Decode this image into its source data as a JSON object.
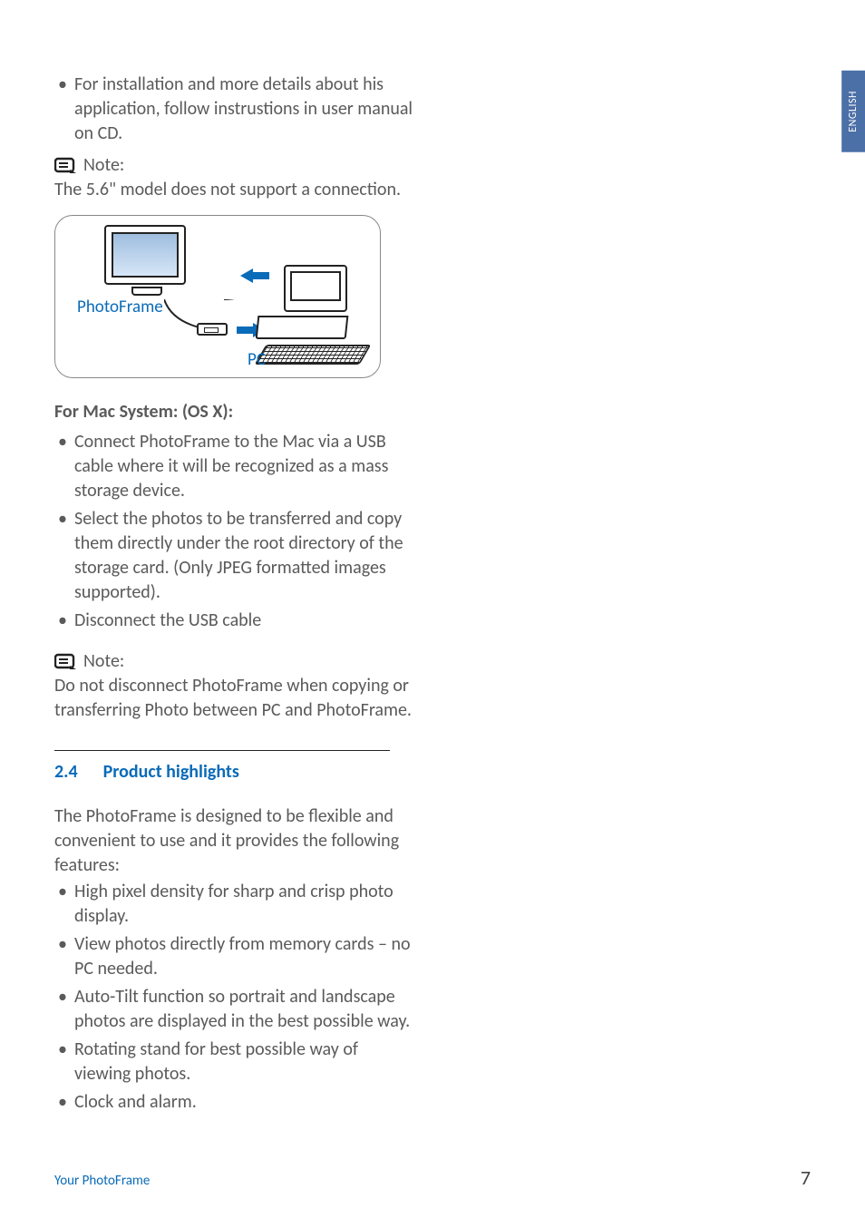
{
  "sideTab": "ENGLISH",
  "topBullet": "For installation and more details about his application, follow instrustions in user manual on CD.",
  "note1": {
    "label": "Note:",
    "body": "The 5.6\" model  does not support a connection."
  },
  "diagram": {
    "photoFrameLabel": "PhotoFrame",
    "pcLabel": "PC"
  },
  "macHeading": "For Mac System: (OS X):",
  "macBullets": [
    "Connect PhotoFrame to the Mac via a USB cable where it will be recognized as a mass storage device.",
    "Select the photos to be transferred and copy them directly under the root directory of the storage card. (Only JPEG formatted images supported).",
    "Disconnect the USB cable"
  ],
  "note2": {
    "label": "Note:",
    "body": "Do not disconnect PhotoFrame when copying or transferring Photo between PC and PhotoFrame."
  },
  "section": {
    "number": "2.4",
    "title": "Product highlights"
  },
  "highlightsIntro": "The PhotoFrame is designed to be flexible and convenient to use and it provides the following features:",
  "highlights": [
    "High pixel density for sharp and crisp photo display.",
    "View photos directly from memory cards – no PC needed.",
    "Auto-Tilt function so portrait and landscape photos are displayed in the best possible way.",
    "Rotating stand for best possible way of viewing photos.",
    "Clock and alarm."
  ],
  "footer": {
    "title": "Your PhotoFrame",
    "page": "7"
  }
}
